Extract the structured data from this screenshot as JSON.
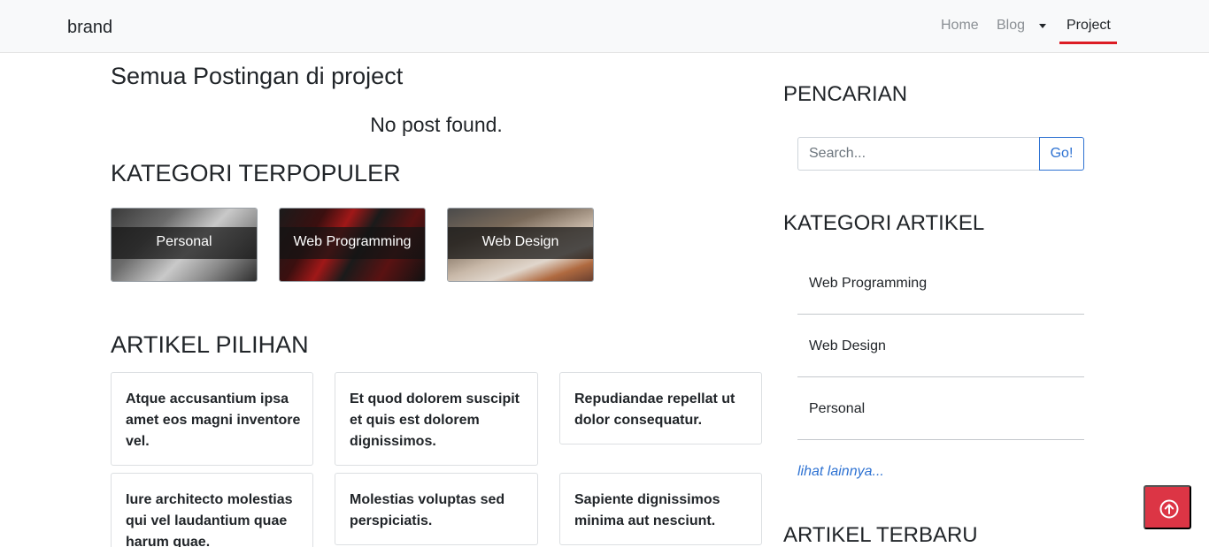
{
  "navbar": {
    "brand": "brand",
    "items": [
      {
        "label": "Home"
      },
      {
        "label": "Blog"
      },
      {
        "label": "Project"
      }
    ]
  },
  "main": {
    "page_title": "Semua Postingan di project",
    "empty_message": "No post found.",
    "popular_heading": "KATEGORI TERPOPULER",
    "popular_categories": [
      {
        "label": "Personal"
      },
      {
        "label": "Web Programming"
      },
      {
        "label": "Web Design"
      }
    ],
    "featured_heading": "ARTIKEL PILIHAN",
    "featured_articles": [
      {
        "title": "Atque accusantium ipsa amet eos magni inventore vel."
      },
      {
        "title": "Et quod dolorem suscipit et quis est dolorem dignissimos."
      },
      {
        "title": "Repudiandae repellat ut dolor consequatur."
      },
      {
        "title": "Iure architecto molestias qui vel laudantium quae harum quae."
      },
      {
        "title": "Molestias voluptas sed perspiciatis."
      },
      {
        "title": "Sapiente dignissimos minima aut nesciunt."
      }
    ]
  },
  "sidebar": {
    "search_heading": "PENCARIAN",
    "search_placeholder": "Search...",
    "search_button": "Go!",
    "category_heading": "KATEGORI ARTIKEL",
    "categories": [
      {
        "label": "Web Programming"
      },
      {
        "label": "Web Design"
      },
      {
        "label": "Personal"
      }
    ],
    "more_link": "lihat lainnya...",
    "latest_heading": "ARTIKEL TERBARU"
  },
  "icons": {
    "scroll_top": "arrow-up-circle-icon",
    "dropdown": "caret-down-icon"
  },
  "colors": {
    "accent": "#dc1c24",
    "link": "#2e72d2",
    "scroll_top_bg": "#dc3545"
  }
}
